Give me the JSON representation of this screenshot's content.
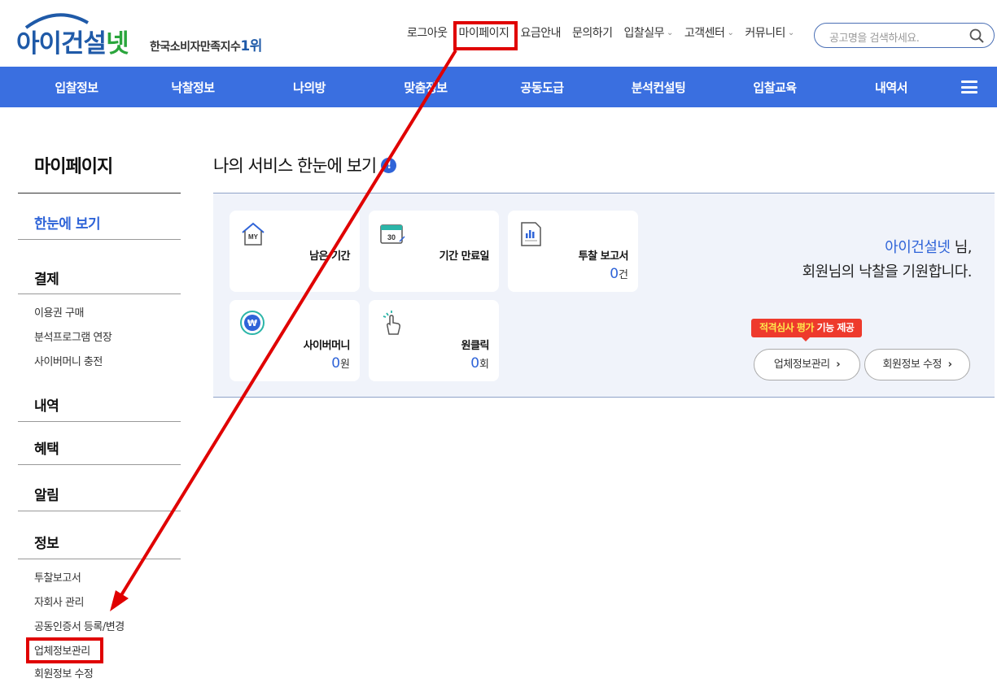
{
  "header": {
    "logo_main": "아이건설",
    "logo_accent": "넷",
    "logo_sub": "한국소비자만족지수",
    "logo_rank": "1위",
    "nav": [
      {
        "label": "로그아웃",
        "chevron": false
      },
      {
        "label": "마이페이지",
        "chevron": false
      },
      {
        "label": "요금안내",
        "chevron": false
      },
      {
        "label": "문의하기",
        "chevron": false
      },
      {
        "label": "입찰실무",
        "chevron": true
      },
      {
        "label": "고객센터",
        "chevron": true
      },
      {
        "label": "커뮤니티",
        "chevron": true
      }
    ],
    "search_placeholder": "공고명을 검색하세요."
  },
  "gnb": [
    "입찰정보",
    "낙찰정보",
    "나의방",
    "맞춤정보",
    "공동도급",
    "분석컨설팅",
    "입찰교육",
    "내역서"
  ],
  "sidebar": {
    "title": "마이페이지",
    "overview": "한눈에 보기",
    "payment": "결제",
    "payment_items": [
      "이용권 구매",
      "분석프로그램 연장",
      "사이버머니 충전"
    ],
    "history": "내역",
    "benefit": "혜택",
    "notice": "알림",
    "info": "정보",
    "info_items": [
      "투찰보고서",
      "자회사 관리",
      "공동인증서 등록/변경",
      "업체정보관리",
      "회원정보 수정"
    ]
  },
  "main": {
    "title": "나의 서비스 한눈에 보기",
    "info_icon": "!",
    "cards": {
      "remaining": {
        "label": "남은 기간",
        "icon_text": "MY"
      },
      "expiry": {
        "label": "기간 만료일",
        "icon_text": "30"
      },
      "report": {
        "label": "투찰 보고서",
        "value": "0",
        "unit": "건"
      },
      "cybermoney": {
        "label": "사이버머니",
        "value": "0",
        "unit": "원",
        "icon_text": "₩"
      },
      "oneclick": {
        "label": "원클릭",
        "value": "0",
        "unit": "회"
      }
    },
    "greeting_name": "아이건설넷",
    "greeting_suffix": " 님,",
    "greeting_line2": "회원님의 낙찰을 기원합니다.",
    "tooltip_highlight": "적격심사 평가",
    "tooltip_rest": " 기능 제공",
    "btn_company": "업체정보관리",
    "btn_member": "회원정보 수정",
    "btn_chevron": "›"
  },
  "colors": {
    "brand_blue": "#3a6fe0",
    "accent_blue": "#2f64d8",
    "highlight_red": "#e00000",
    "tooltip_red": "#ee3a2c"
  }
}
